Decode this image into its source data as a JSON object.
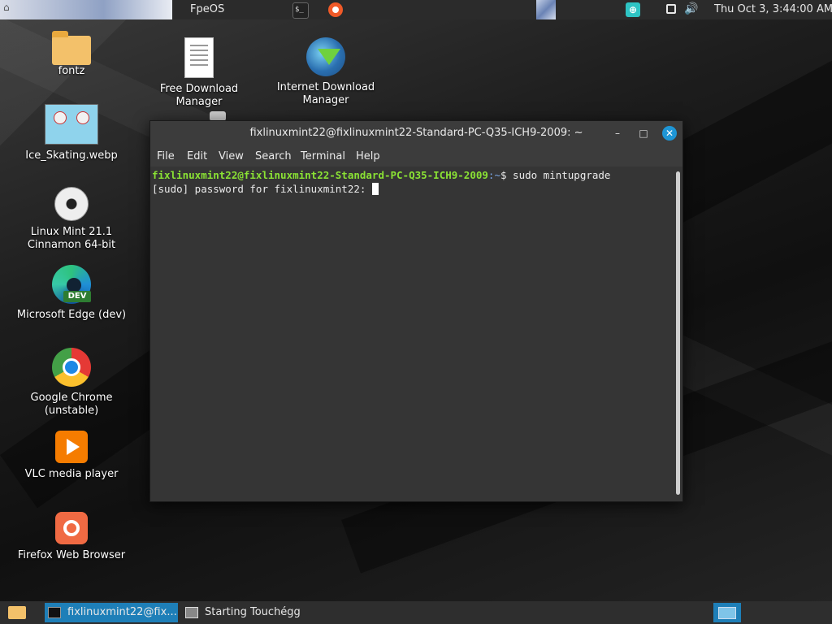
{
  "top_panel": {
    "workspace_name": "FpeOS",
    "terminal_icon_label": "$_",
    "clock": "Thu Oct  3,  3:44:00 AM",
    "icons": [
      "terminal-icon",
      "firefox-icon",
      "bag-icon",
      "window-icon",
      "volume-icon"
    ]
  },
  "desktop": {
    "icons": [
      {
        "label": "fontz",
        "icon": "folder-icon"
      },
      {
        "label": "Free Download Manager",
        "icon": "document-icon"
      },
      {
        "label": "Internet Download Manager",
        "icon": "idm-icon"
      },
      {
        "label": "Ice_Skating.webp",
        "icon": "image-icon"
      },
      {
        "label": "Linux Mint 21.1 Cinnamon 64-bit",
        "icon": "disc-icon"
      },
      {
        "label": "Microsoft Edge (dev)",
        "icon": "edge-dev-icon",
        "badge": "DEV"
      },
      {
        "label": "Google Chrome (unstable)",
        "icon": "chrome-icon"
      },
      {
        "label": "VLC media player",
        "icon": "vlc-icon"
      },
      {
        "label": "Firefox Web Browser",
        "icon": "firefox-icon"
      }
    ]
  },
  "terminal": {
    "title": "fixlinuxmint22@fixlinuxmint22-Standard-PC-Q35-ICH9-2009: ~",
    "window_buttons": {
      "minimize": "–",
      "maximize": "□",
      "close": "✕"
    },
    "menu": [
      "File",
      "Edit",
      "View",
      "Search",
      "Terminal",
      "Help"
    ],
    "lines": [
      {
        "user_host": "fixlinuxmint22@fixlinuxmint22-Standard-PC-Q35-ICH9-2009",
        "path": ":~",
        "prompt_symbol": "$ ",
        "command": "sudo mintupgrade"
      },
      {
        "text": "[sudo] password for fixlinuxmint22: "
      }
    ]
  },
  "bottom_panel": {
    "tasks": [
      {
        "label": "fixlinuxmint22@fix...",
        "active": true
      },
      {
        "label": "Starting Touchégg",
        "active": false
      }
    ]
  },
  "colors": {
    "prompt_user": "#8ae234",
    "prompt_path": "#7aa7e8",
    "accent": "#1e7fb8",
    "close_button": "#1e96d6"
  }
}
